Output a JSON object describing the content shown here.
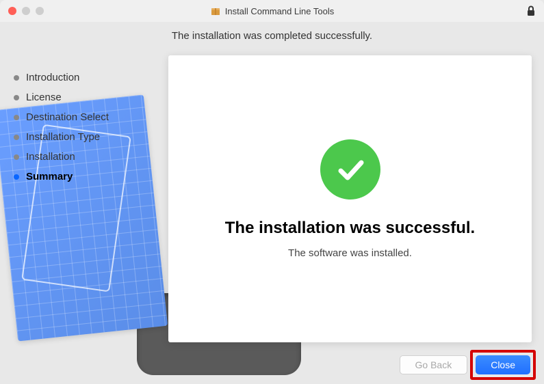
{
  "window": {
    "title": "Install Command Line Tools"
  },
  "subtitle": "The installation was completed successfully.",
  "steps": [
    {
      "label": "Introduction",
      "active": false
    },
    {
      "label": "License",
      "active": false
    },
    {
      "label": "Destination Select",
      "active": false
    },
    {
      "label": "Installation Type",
      "active": false
    },
    {
      "label": "Installation",
      "active": false
    },
    {
      "label": "Summary",
      "active": true
    }
  ],
  "main": {
    "title": "The installation was successful.",
    "subtitle": "The software was installed."
  },
  "buttons": {
    "go_back": "Go Back",
    "close": "Close"
  },
  "colors": {
    "success_green": "#4cc84c",
    "primary_blue": "#1f6fff",
    "highlight_red": "#d40000"
  }
}
